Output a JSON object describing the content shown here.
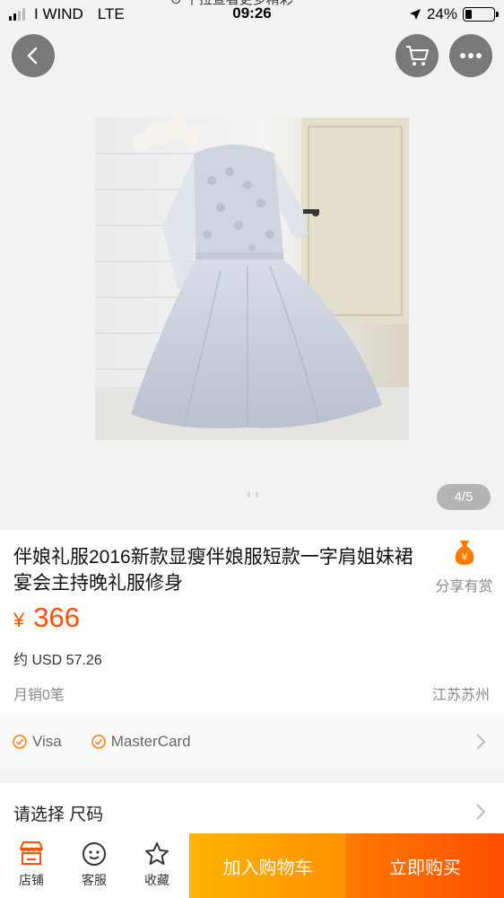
{
  "status_bar": {
    "carrier": "I WIND",
    "network": "LTE",
    "time": "09:26",
    "pull_hint": "下拉查看更多精彩",
    "battery": "24%",
    "battery_level": 0.24
  },
  "gallery": {
    "counter": "4/5",
    "current_index": 4,
    "total": 5
  },
  "product": {
    "title": "伴娘礼服2016新款显瘦伴娘服短款一字肩姐妹裙宴会主持晚礼服修身",
    "share_label": "分享有赏",
    "currency_symbol": "¥",
    "price": "366",
    "usd_price": "约 USD 57.26",
    "monthly_sales": "月销0笔",
    "location": "江苏苏州"
  },
  "payment": {
    "methods": [
      "Visa",
      "MasterCard"
    ]
  },
  "options": {
    "label": "请选择 尺码"
  },
  "bottom_bar": {
    "shop": "店铺",
    "service": "客服",
    "favorite": "收藏",
    "add_to_cart": "加入购物车",
    "buy_now": "立即购买"
  },
  "colors": {
    "accent": "#ff5000",
    "cart_button": "#ff9f00",
    "buy_button": "#ff5f00"
  }
}
